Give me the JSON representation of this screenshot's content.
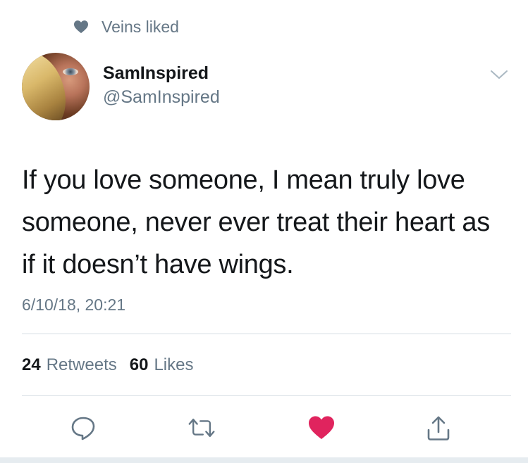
{
  "social_context": {
    "text": "Veins liked",
    "icon": "heart-icon"
  },
  "author": {
    "name": "SamInspired",
    "handle": "@SamInspired"
  },
  "tweet": {
    "text": "If you love someone, I mean truly love someone, never ever treat their heart as if it doesn’t have wings.",
    "timestamp": "6/10/18, 20:21"
  },
  "stats": {
    "retweets_count": "24",
    "retweets_label": "Retweets",
    "likes_count": "60",
    "likes_label": "Likes"
  },
  "actions": [
    {
      "name": "reply",
      "icon": "reply-icon"
    },
    {
      "name": "retweet",
      "icon": "retweet-icon"
    },
    {
      "name": "like",
      "icon": "heart-icon",
      "active": true
    },
    {
      "name": "share",
      "icon": "share-icon"
    }
  ],
  "colors": {
    "secondary_text": "#657786",
    "primary_text": "#14171a",
    "like_active": "#e0245e",
    "divider": "#d6dde3"
  }
}
